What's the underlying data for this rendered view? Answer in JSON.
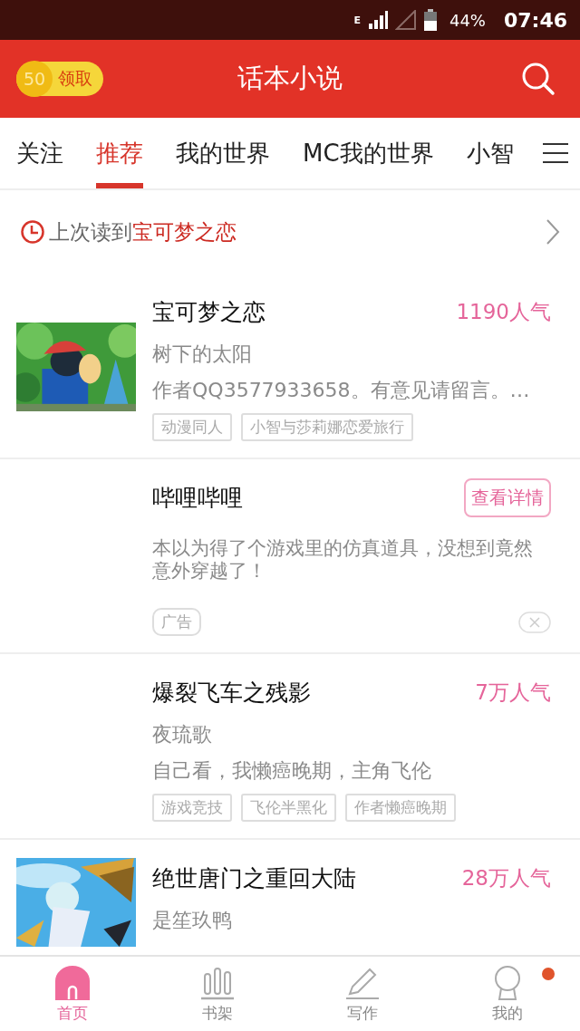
{
  "status_bar": {
    "battery_percent": "44%",
    "time": "07:46",
    "network": "E"
  },
  "header": {
    "reward": {
      "coins": "50",
      "label": "领取"
    },
    "title": "话本小说"
  },
  "tabs": [
    {
      "label": "关注",
      "selected": false
    },
    {
      "label": "推荐",
      "selected": true
    },
    {
      "label": "我的世界",
      "selected": false
    },
    {
      "label": "MC我的世界",
      "selected": false
    },
    {
      "label": "小智",
      "selected": false
    }
  ],
  "last_read": {
    "prefix": "上次读到",
    "book": "宝可梦之恋"
  },
  "feed": [
    {
      "kind": "book",
      "cover": {
        "kind": "picture"
      },
      "title": "宝可梦之恋",
      "popularity": "1190人气",
      "author": "树下的太阳",
      "description": "作者QQ3577933658。有意见请留言。…",
      "tags": [
        "动漫同人",
        "小智与莎莉娜恋爱旅行"
      ]
    },
    {
      "kind": "ad",
      "title": "哔哩哔哩",
      "action": "查看详情",
      "description": "本以为得了个游戏里的仿真道具，没想到竟然意外穿越了！",
      "tags": [
        "广告"
      ]
    },
    {
      "kind": "book",
      "title": "爆裂飞车之残影",
      "popularity": "7万人气",
      "author": "夜琉歌",
      "description": "自己看，我懒癌晚期，主角飞伦",
      "tags": [
        "游戏竞技",
        "飞伦半黑化",
        "作者懒癌晚期"
      ]
    },
    {
      "kind": "book",
      "cover": {
        "kind": "picture"
      },
      "title": "绝世唐门之重回大陆",
      "popularity": "28万人气",
      "author": "是笙玖鸭"
    }
  ],
  "bottom_nav": [
    {
      "label": "首页",
      "selected": true,
      "badge": false
    },
    {
      "label": "书架",
      "selected": false,
      "badge": false
    },
    {
      "label": "写作",
      "selected": false,
      "badge": false
    },
    {
      "label": "我的",
      "selected": false,
      "badge": true
    }
  ]
}
